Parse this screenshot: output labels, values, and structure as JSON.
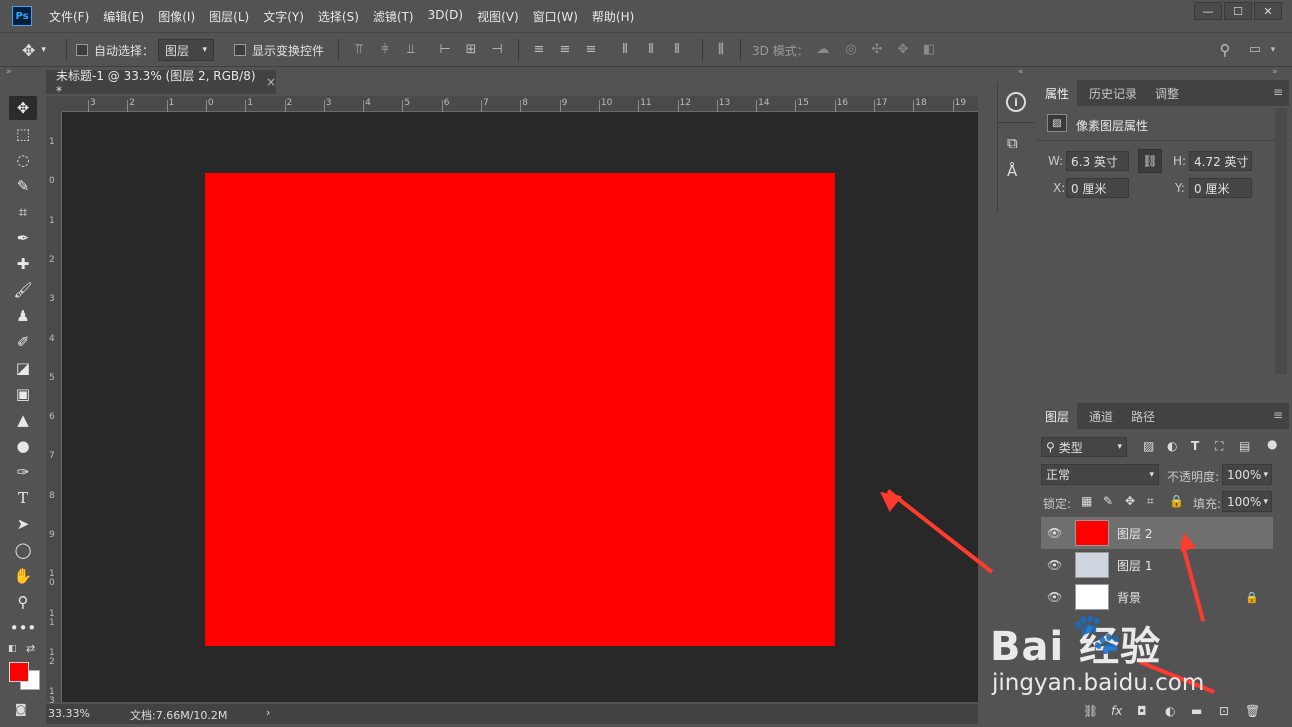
{
  "app": {
    "menu": [
      "文件(F)",
      "编辑(E)",
      "图像(I)",
      "图层(L)",
      "文字(Y)",
      "选择(S)",
      "滤镜(T)",
      "3D(D)",
      "视图(V)",
      "窗口(W)",
      "帮助(H)"
    ],
    "logo_text": "Ps"
  },
  "options": {
    "auto_select_label": "自动选择：",
    "auto_select_value": "图层",
    "show_transform_label": "显示变换控件",
    "mode_3d_label": "3D 模式："
  },
  "document": {
    "tab_title": "未标题-1 @ 33.3% (图层 2, RGB/8) *",
    "tab_close": "×",
    "ruler_top_numbers": [
      "3",
      "2",
      "1",
      "0",
      "1",
      "2",
      "3",
      "4",
      "5",
      "6",
      "7",
      "8",
      "9",
      "10",
      "11",
      "12",
      "13",
      "14",
      "15",
      "16",
      "17",
      "18",
      "19"
    ],
    "ruler_left_numbers": [
      "1",
      "0",
      "1",
      "2",
      "3",
      "4",
      "5",
      "6",
      "7",
      "8",
      "9",
      "1 0",
      "1 1",
      "1 2",
      "1 3"
    ],
    "zoom": "33.33%",
    "doc_info": "文档:7.66M/10.2M",
    "artboard_color": "#ff0000"
  },
  "properties": {
    "tabs": [
      "属性",
      "历史记录",
      "调整"
    ],
    "title": "像素图层属性",
    "w_label": "W:",
    "w_value": "6.3 英寸",
    "h_label": "H:",
    "h_value": "4.72 英寸",
    "x_label": "X:",
    "x_value": "0 厘米",
    "y_label": "Y:",
    "y_value": "0 厘米"
  },
  "layers_panel": {
    "tabs": [
      "图层",
      "通道",
      "路径"
    ],
    "filter_value": "类型",
    "blend_mode": "正常",
    "opacity_label": "不透明度:",
    "opacity_value": "100%",
    "lock_label": "锁定:",
    "fill_label": "填充:",
    "fill_value": "100%",
    "layers": [
      {
        "name": "图层 2",
        "selected": true,
        "thumb": "#ff0000"
      },
      {
        "name": "图层 1",
        "selected": false,
        "thumb": "#cfd6e0"
      },
      {
        "name": "背景",
        "selected": false,
        "thumb": "#ffffff"
      }
    ],
    "footer_fx": "fx"
  },
  "watermark": {
    "brand": "Bai  经验",
    "url": "jingyan.baidu.com"
  },
  "colors": {
    "foreground": "#ff0000",
    "background": "#ffffff",
    "annotation_arrow": "#ff3b2f"
  }
}
